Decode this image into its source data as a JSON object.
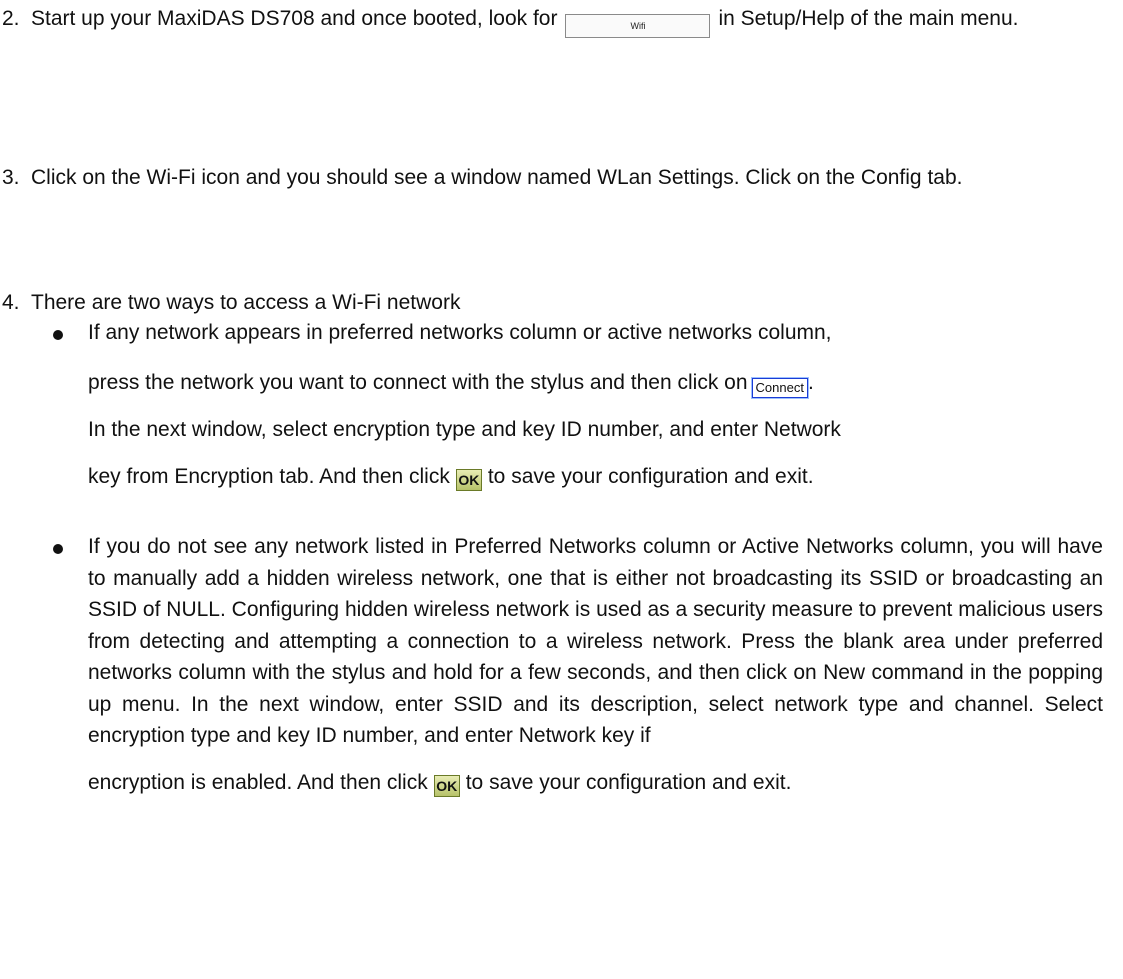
{
  "step2": {
    "number": "2.",
    "text_before": "Start up your MaxiDAS DS708 and once booted, look for",
    "button_label": "Wifi",
    "text_after": "in Setup/Help of the main menu."
  },
  "step3": {
    "number": "3.",
    "text": "Click on the Wi-Fi icon and you should see a window named WLan Settings. Click on the Config tab."
  },
  "step4": {
    "number": "4.",
    "text": "There are two ways to access a Wi-Fi network",
    "bullet1": {
      "line1": "If any network appears in preferred networks column or active networks column,",
      "line2_before": "press the network you want to connect with the stylus and then click on",
      "connect_label": "Connect",
      "line2_after": ".",
      "line3": "In the next window, select encryption type and key ID number, and enter Network",
      "line4_before": "key from Encryption tab. And then click",
      "ok_label": "OK",
      "line4_after": "to save your configuration and exit."
    },
    "bullet2": {
      "body": "If you do not see any network listed in Preferred Networks column or Active Networks column, you will have to manually add a hidden wireless network, one that is either not broadcasting its SSID or broadcasting an SSID of NULL. Configuring hidden wireless network is used as a security measure to prevent malicious users from detecting and attempting a connection to a wireless network. Press the blank area under preferred networks column with the stylus and hold for a few seconds, and then click on New command in the popping up menu. In the next window, enter SSID and its description, select network type and channel. Select encryption type and key ID number, and enter Network key if",
      "last_before": "encryption is enabled. And then click",
      "ok_label": "OK",
      "last_after": "to save your configuration and exit."
    }
  }
}
